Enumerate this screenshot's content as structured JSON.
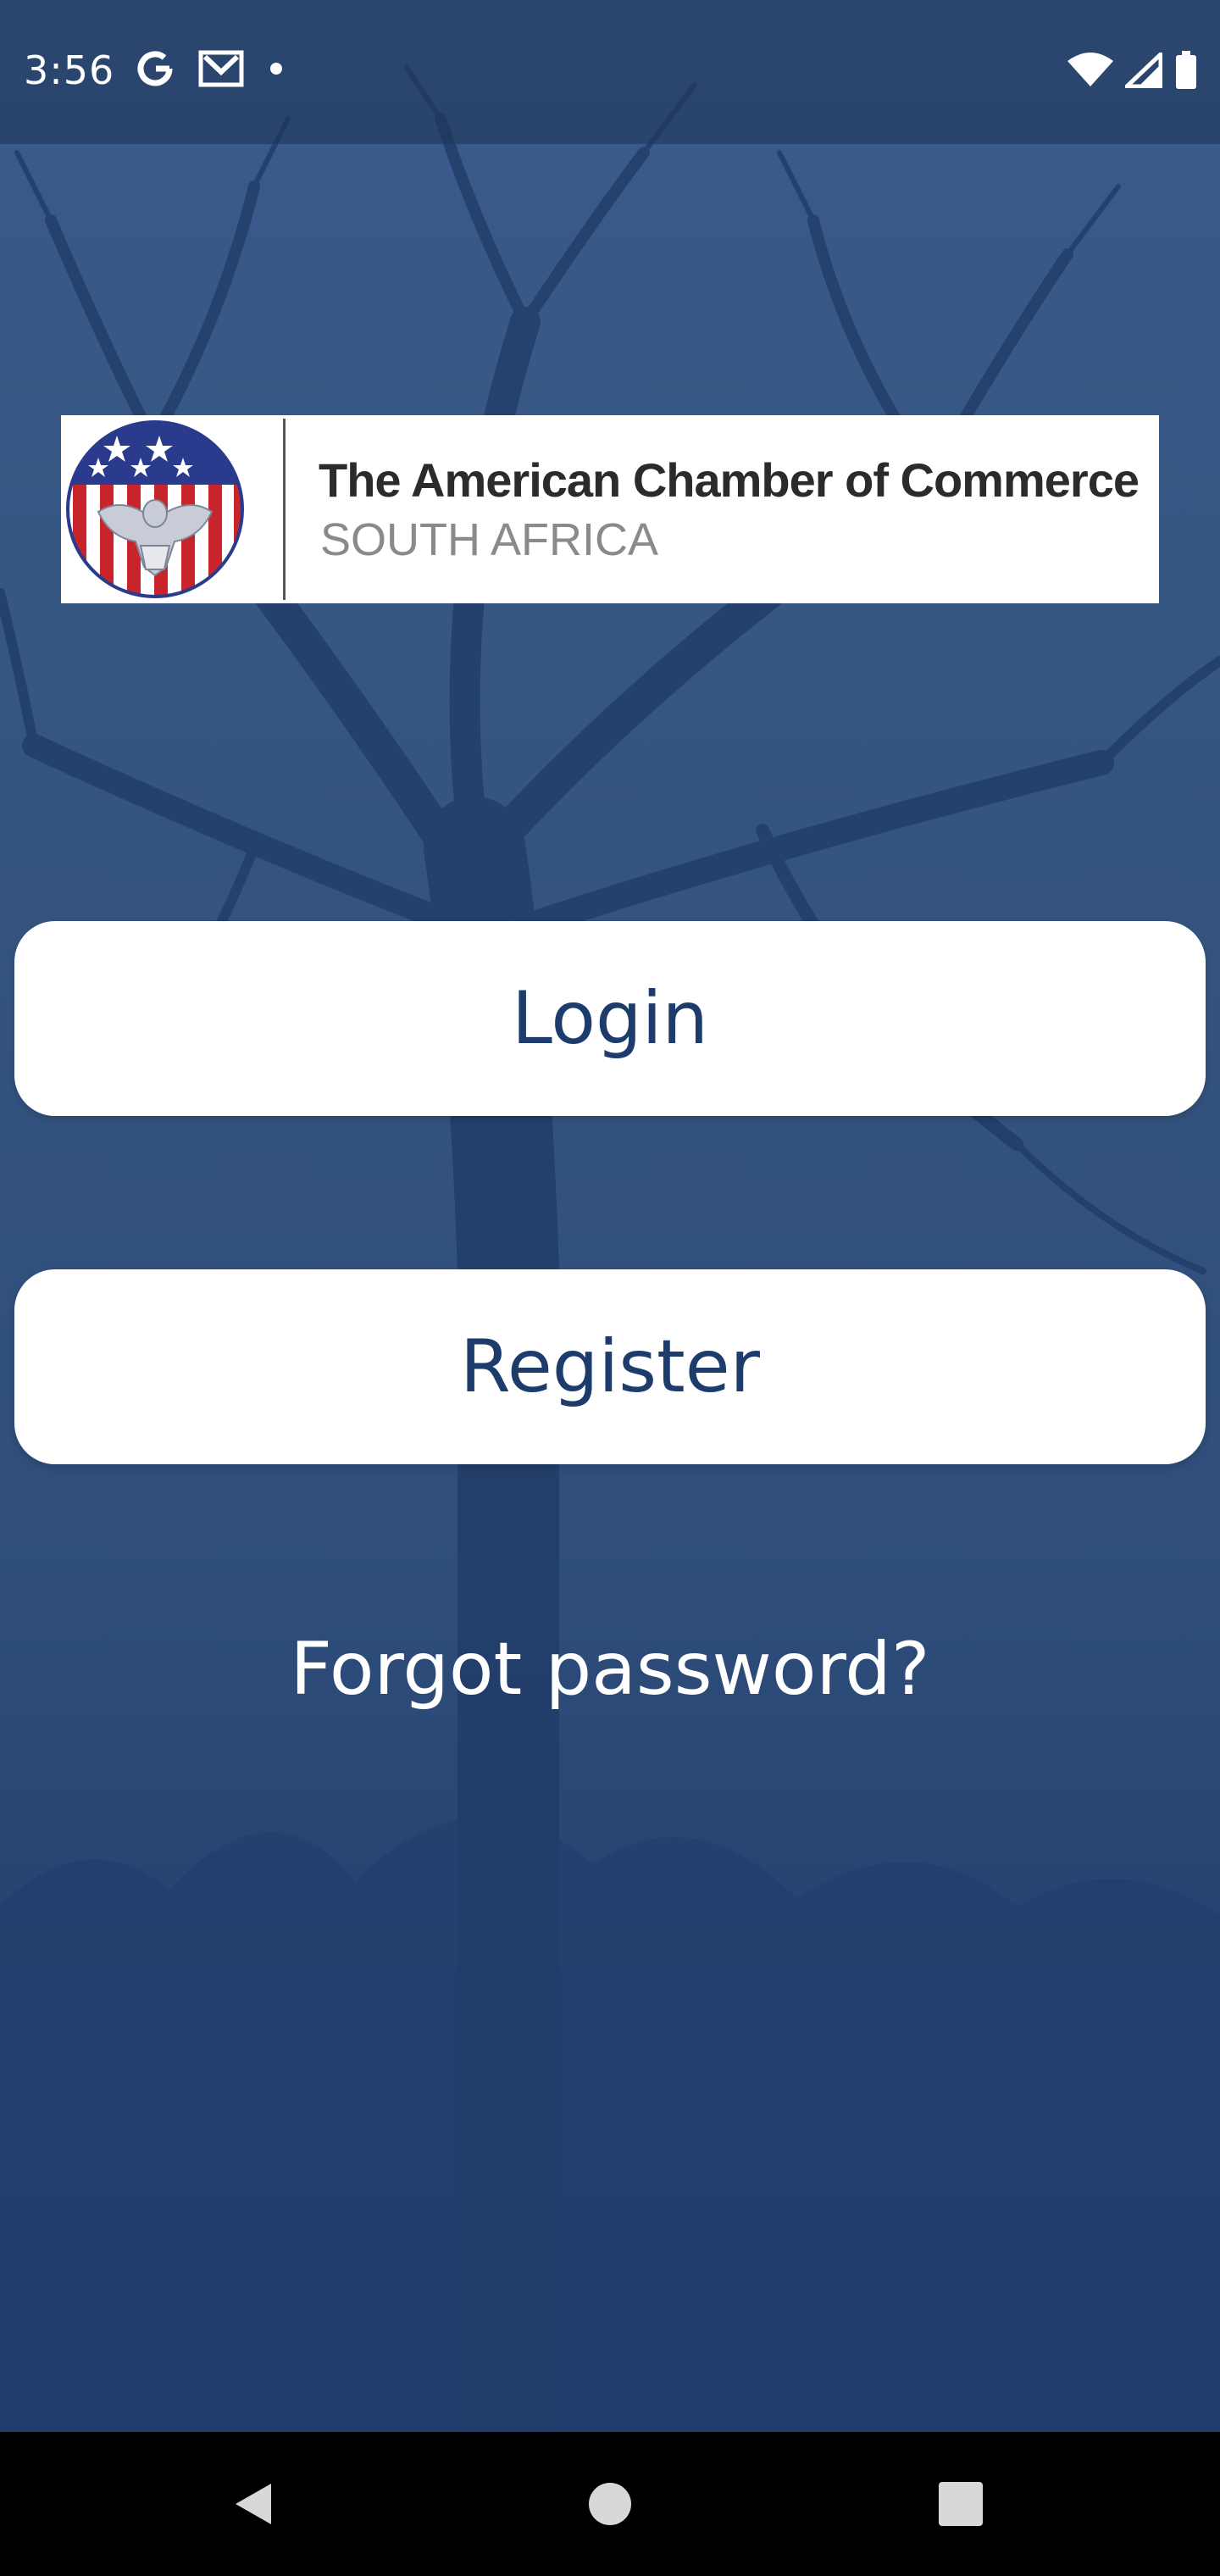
{
  "status_bar": {
    "time": "3:56",
    "left_icons": [
      "google-icon",
      "gmail-icon",
      "notification-dot-icon"
    ],
    "right_icons": [
      "wifi-icon",
      "cell-signal-icon",
      "battery-icon"
    ]
  },
  "logo": {
    "title": "The American Chamber of Commerce",
    "subtitle": "SOUTH AFRICA",
    "colors": {
      "seal_blue": "#2a3a8c",
      "seal_red": "#c8242b"
    }
  },
  "actions": {
    "login_label": "Login",
    "register_label": "Register",
    "forgot_label": "Forgot password?"
  },
  "nav_bar": {
    "buttons": [
      "back-icon",
      "home-icon",
      "recents-icon"
    ]
  },
  "colors": {
    "background": "#2f4e7b",
    "button_text": "#1d3c6b",
    "button_bg": "#ffffff"
  }
}
